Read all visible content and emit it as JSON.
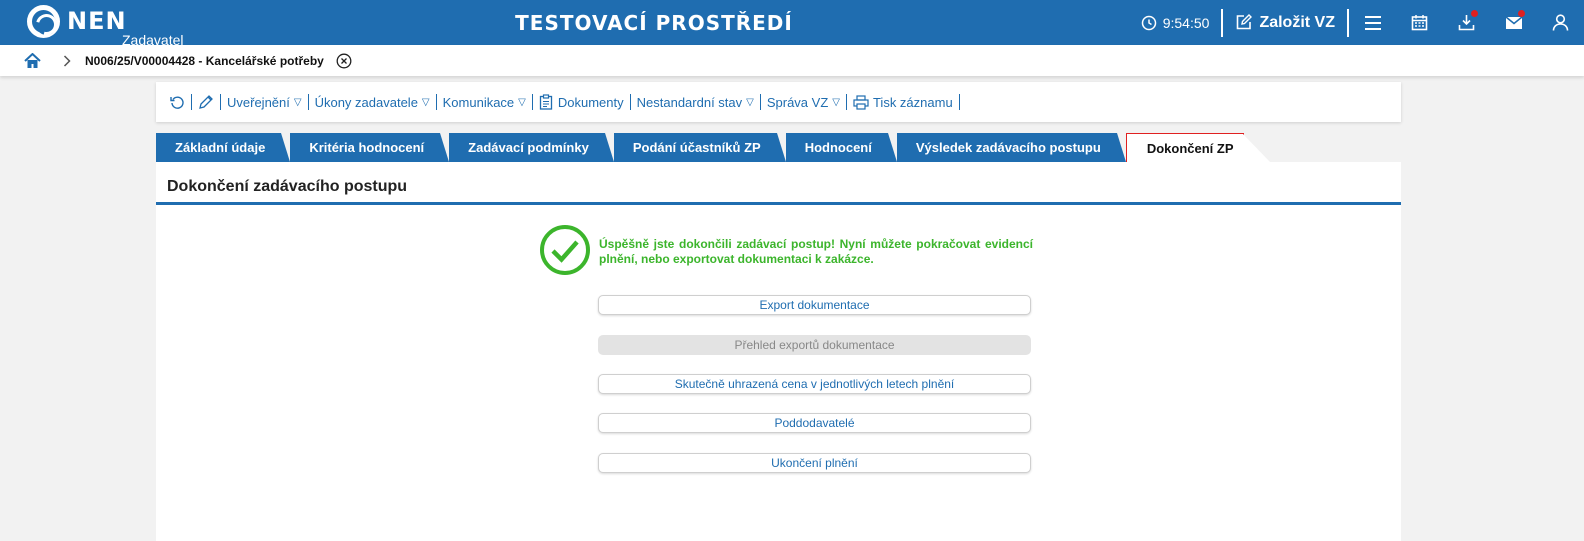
{
  "topbar": {
    "logo_text": "NEN",
    "logo_sub": "Zadavatel",
    "env_title": "TESTOVACÍ PROSTŘEDÍ",
    "time": "9:54:50",
    "create_label": "Založit VZ",
    "icons": [
      "clock-icon",
      "edit-icon",
      "menu-icon",
      "calendar-icon",
      "download-icon",
      "mail-icon",
      "user-icon"
    ],
    "accent": "#1f6db0",
    "notification_color": "#e02020"
  },
  "breadcrumb": {
    "item": "N006/25/V00004428 - Kancelářské potřeby"
  },
  "toolbar": {
    "items": [
      "Uveřejnění",
      "Úkony zadavatele",
      "Komunikace",
      "Dokumenty",
      "Nestandardní stav",
      "Správa VZ",
      "Tisk záznamu"
    ]
  },
  "tabs": [
    "Základní údaje",
    "Kritéria hodnocení",
    "Zadávací podmínky",
    "Podání účastníků ZP",
    "Hodnocení",
    "Výsledek zadávacího postupu",
    "Dokončení ZP"
  ],
  "active_tab": "Dokončení ZP",
  "panel": {
    "title": "Dokončení zadávacího postupu",
    "success_message": "Úspěšně jste dokončili zadávací postup! Nyní můžete pokračovat evidencí plnění, nebo exportovat dokumentaci k zakázce.",
    "success_color": "#3cb52c",
    "buttons": [
      {
        "label": "Export dokumentace"
      },
      {
        "label": "Přehled exportů dokumentace"
      },
      {
        "label": "Skutečně uhrazená cena v jednotlivých letech plnění"
      },
      {
        "label": "Poddodavatelé"
      },
      {
        "label": "Ukončení plnění"
      }
    ]
  }
}
